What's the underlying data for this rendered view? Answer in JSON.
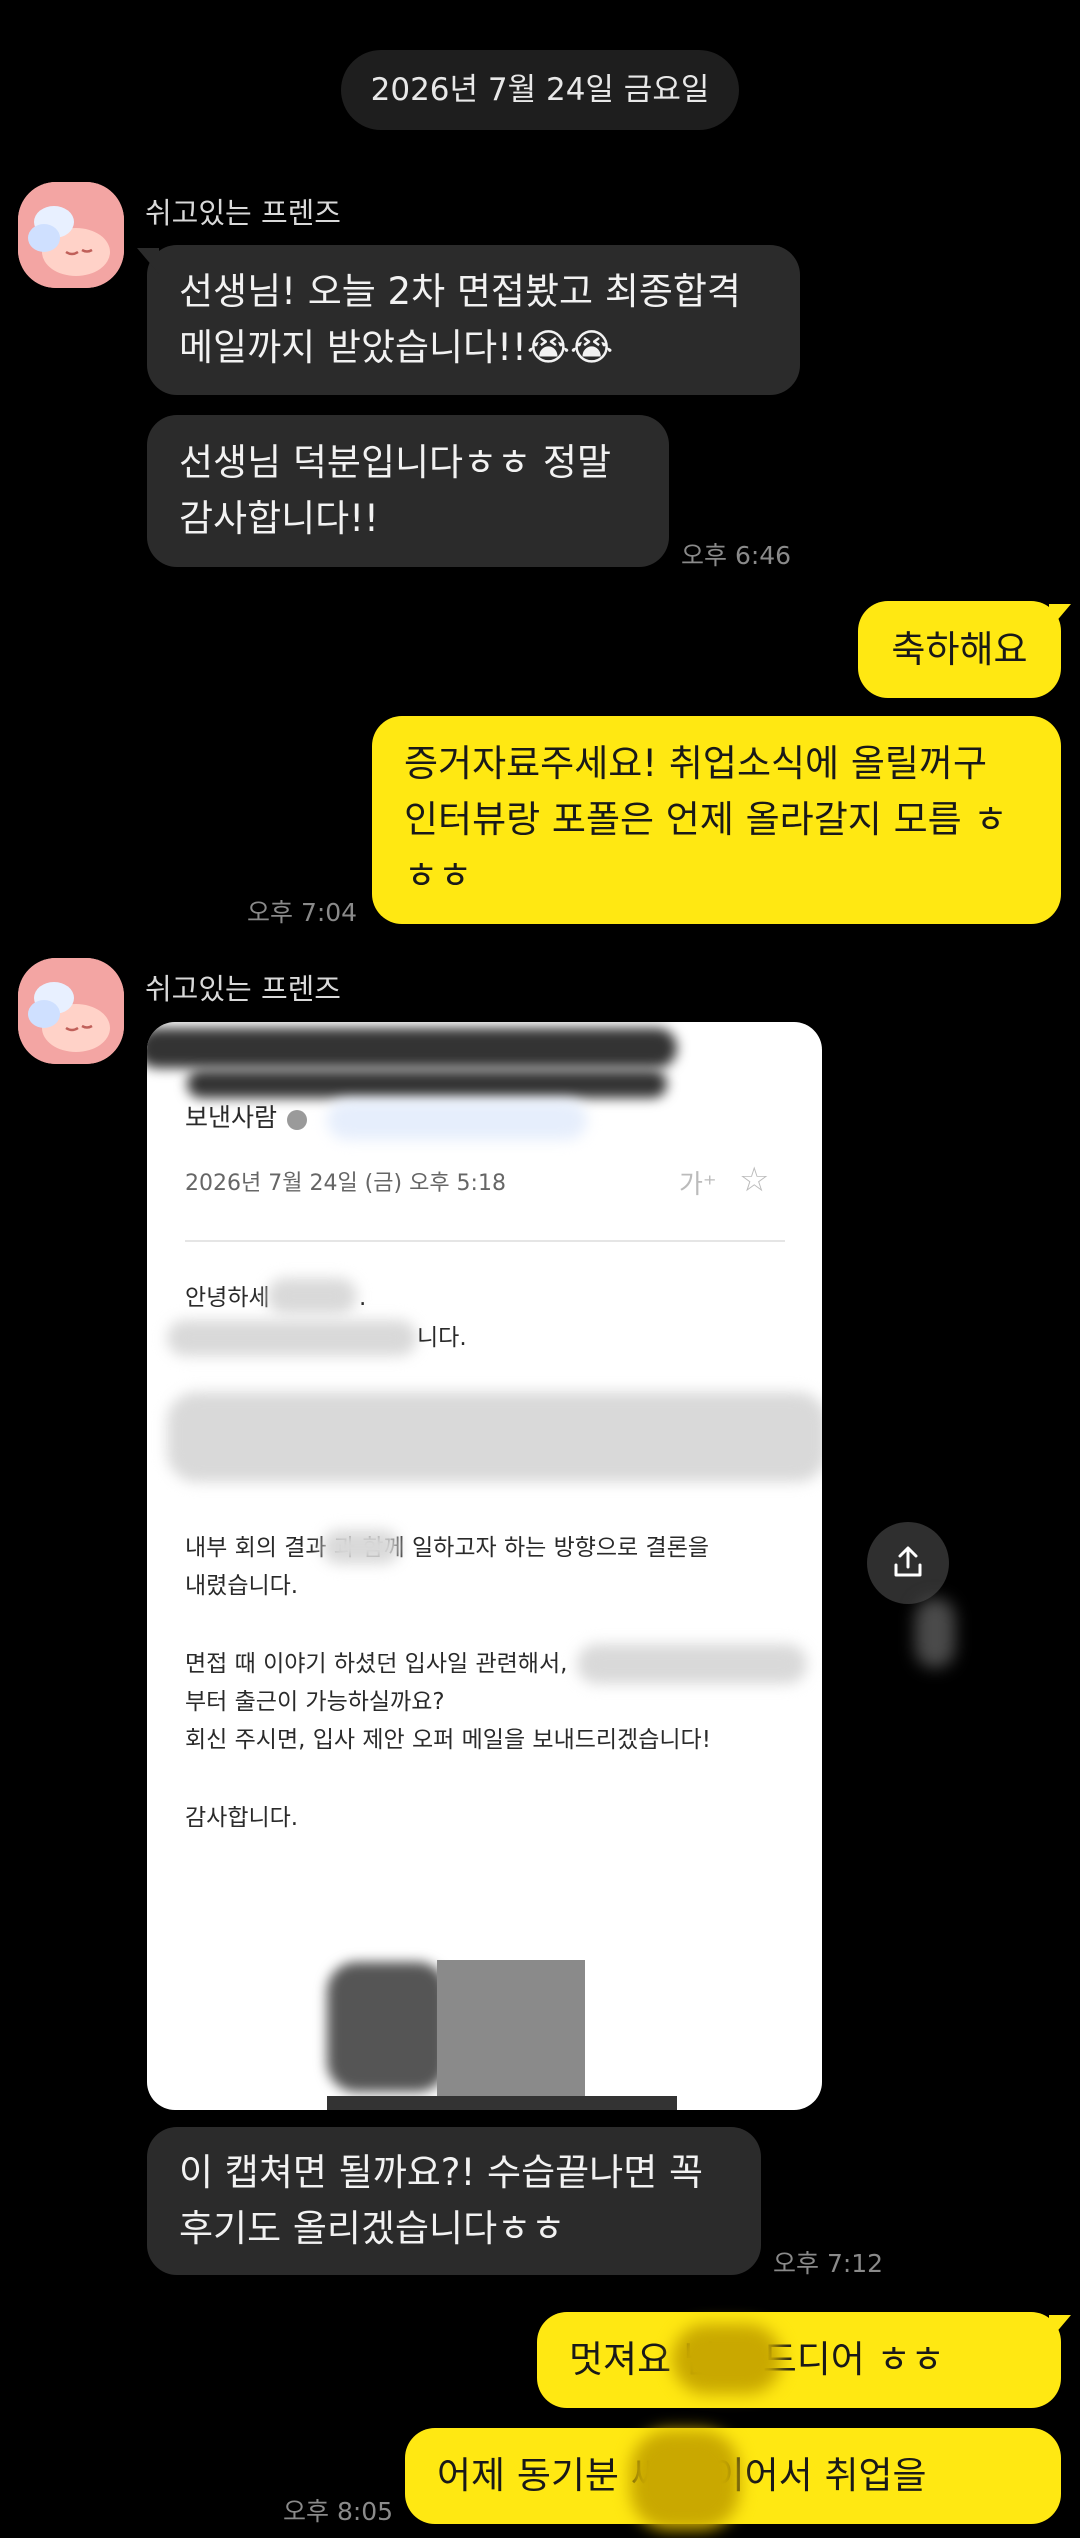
{
  "date_divider": "2026년 7월 24일 금요일",
  "friend": {
    "name": "쉬고있는 프렌즈",
    "avatar_icon": "peach-character-icon"
  },
  "messages": [
    {
      "from": "friend",
      "text": "선생님! 오늘 2차 면접봤고 최종합격\n메일까지 받았습니다!!😭😭"
    },
    {
      "from": "friend",
      "text": "선생님 덕분입니다ㅎㅎ 정말\n감사합니다!!",
      "time": "오후 6:46"
    },
    {
      "from": "me",
      "text": "축하해요"
    },
    {
      "from": "me",
      "text": "증거자료주세요! 취업소식에 올릴꺼구\n인터뷰랑 포폴은 언제 올라갈지 모름 ㅎ\nㅎㅎ",
      "time": "오후 7:04"
    },
    {
      "from": "friend",
      "text": "이 캡쳐면 될까요?! 수습끝나면 꼭\n후기도 올리겠습니다ㅎㅎ",
      "time": "오후 7:12"
    },
    {
      "from": "me",
      "text": "멋져요         님도 드디어 ㅎㅎ"
    },
    {
      "from": "me",
      "text": "어제 동기분        씨에 이어서 취업을",
      "time": "오후 8:05"
    }
  ],
  "email_screenshot": {
    "sender_label": "보낸사람",
    "date": "2026년 7월 24일 (금) 오후 5:18",
    "font_size_icon": "가⁺",
    "star_icon": "star-outline-icon",
    "lines": {
      "greeting": "안녕하세",
      "greeting_tail": ".",
      "line2_tail": "니다.",
      "p1a": "내부 회의 결과          과 함께 일하고자 하는 방향으로 결론을",
      "p1b": "내렸습니다.",
      "p2a": "면접 때 이야기 하셨던 입사일 관련해서,",
      "p2b": "부터 출근이 가능하실까요?",
      "p2c": "회신 주시면, 입사 제안 오퍼 메일을 보내드리겠습니다!",
      "closing": "감사합니다."
    }
  },
  "share_icon": "share-upload-icon"
}
